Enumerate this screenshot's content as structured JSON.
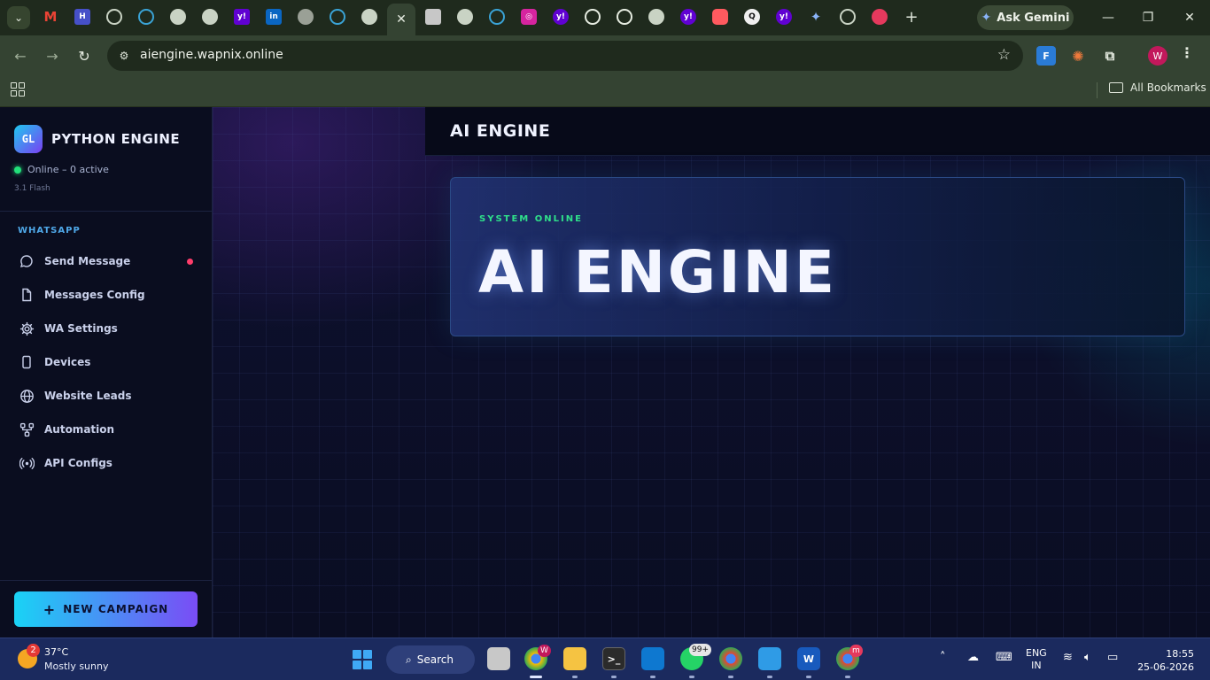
{
  "browser": {
    "url": "aiengine.wapnix.online",
    "gemini_label": "Ask Gemini",
    "all_bookmarks": "All Bookmarks",
    "profile_initial": "W",
    "tabs": [
      {
        "icon": "gmail-icon",
        "color": "#ea4335"
      },
      {
        "icon": "app-icon",
        "color": "#5b6ff5"
      },
      {
        "icon": "globe-icon",
        "color": "#8c9a86"
      },
      {
        "icon": "globe-icon",
        "color": "#3aa3d6"
      },
      {
        "icon": "globe-icon",
        "color": "#8c9a86"
      },
      {
        "icon": "globe-icon",
        "color": "#8c9a86"
      },
      {
        "icon": "yahoo-icon",
        "color": "#6001d2"
      },
      {
        "icon": "linkedin-icon",
        "color": "#0a66c2"
      },
      {
        "icon": "app-icon",
        "color": "#b0b0b0"
      },
      {
        "icon": "app-icon",
        "color": "#3aa3d6"
      },
      {
        "icon": "globe-icon",
        "color": "#8c9a86"
      }
    ]
  },
  "sidebar": {
    "logo_text": "GL",
    "brand": "PYTHON ENGINE",
    "status": "Online – 0 active",
    "version": "3.1 Flash",
    "section": "WHATSAPP",
    "items": [
      {
        "label": "Send Message",
        "icon": "chat-bubble-icon"
      },
      {
        "label": "Messages Config",
        "icon": "document-icon"
      },
      {
        "label": "WA Settings",
        "icon": "gear-icon"
      },
      {
        "label": "Devices",
        "icon": "phone-icon"
      },
      {
        "label": "Website Leads",
        "icon": "globe-icon"
      },
      {
        "label": "Automation",
        "icon": "workflow-icon"
      },
      {
        "label": "API Configs",
        "icon": "broadcast-icon"
      }
    ],
    "campaign_button": "NEW CAMPAIGN"
  },
  "header": {
    "title": "AI ENGINE"
  },
  "hero": {
    "kicker": "SYSTEM ONLINE",
    "title": "AI ENGINE"
  },
  "taskbar": {
    "weather_badge": "2",
    "temperature": "37°C",
    "weather": "Mostly sunny",
    "search": "Search",
    "whatsapp_badge": "99+",
    "chrome_badge": "W",
    "chrome2_badge": "m",
    "lang_top": "ENG",
    "lang_bottom": "IN",
    "time": "18:55",
    "date": "25-06-2026"
  },
  "colors": {
    "accent_cyan": "#19d3f5",
    "accent_violet": "#7a4cf5",
    "online_green": "#22e07a",
    "alert_dot": "#ff3d6b"
  }
}
